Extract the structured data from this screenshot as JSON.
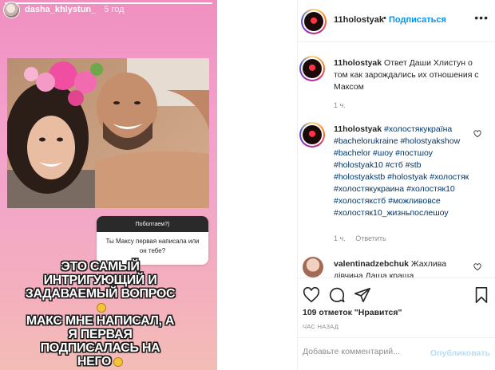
{
  "story": {
    "username": "dasha_khlystun_",
    "time": "5 год",
    "question": {
      "header": "Поболтаем?)",
      "text": "Ты Максу первая написала или он тебе?"
    },
    "caption_lines": [
      "ЭТО САМЫЙ",
      "ИНТРИГУЮЩИЙ И",
      "ЗАДАВАЕМЫЙ ВОПРОС",
      "МАКС МНЕ НАПИСАЛ, А",
      "Я ПЕРВАЯ",
      "ПОДПИСАЛАСЬ НА",
      "НЕГО"
    ]
  },
  "post": {
    "header": {
      "username": "11holostyak",
      "dot": "•",
      "follow_label": "Подписаться",
      "more_icon": "more-horizontal-icon"
    },
    "caption": {
      "username": "11holostyak",
      "text": "Ответ Даши Хлистун о том как зарождались их отношения с Максом",
      "time": "1 ч."
    },
    "comments": [
      {
        "username": "11holostyak",
        "hashtags": "#холостякукраїна #bachelorukraine #holostyakshow #bachelor #шоу #постшоу #holostyak10 #стб #stb #holostyakstb #holostyak #холостяк #холостякукраина #холостяк10 #холостякстб #можливовсе #холостяк10_жизньпослешоу",
        "time": "1 ч.",
        "reply_label": "Ответить"
      },
      {
        "username": "valentinadzebchuk",
        "text": "Жахлива дівчина Даша краща"
      }
    ],
    "likes": "109 отметок \"Нравится\"",
    "posted": "ЧАС НАЗАД",
    "add_comment_placeholder": "Добавьте комментарий...",
    "publish_label": "Опубликовать"
  },
  "colors": {
    "accent": "#0095f6",
    "story_pink": "#f08fc0",
    "text": "#262626",
    "muted": "#8e8e8e",
    "hashtag": "#00376b"
  }
}
